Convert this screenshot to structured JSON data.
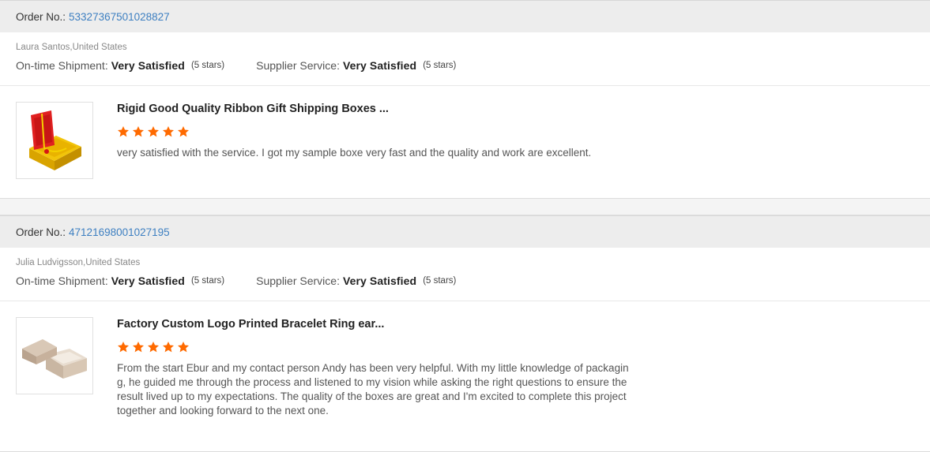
{
  "labels": {
    "order_no": "Order No.:",
    "shipment": "On-time Shipment:",
    "supplier": "Supplier Service:"
  },
  "reviews": [
    {
      "order_no": "53327367501028827",
      "buyer": "Laura Santos,United States",
      "shipment_value": "Very Satisfied",
      "shipment_stars": "(5 stars)",
      "supplier_value": "Very Satisfied",
      "supplier_stars": "(5 stars)",
      "product_title": "Rigid Good Quality Ribbon Gift Shipping Boxes ...",
      "rating": 5,
      "text": "very satisfied with the service. I got my sample boxe very fast and the quality and work are excellent.",
      "image_icon": "red-gift-box-image"
    },
    {
      "order_no": "47121698001027195",
      "buyer": "Julia Ludvigsson,United States",
      "shipment_value": "Very Satisfied",
      "shipment_stars": "(5 stars)",
      "supplier_value": "Very Satisfied",
      "supplier_stars": "(5 stars)",
      "product_title": "Factory Custom Logo Printed Bracelet Ring ear...",
      "rating": 5,
      "text": "From the start Ebur and my contact person Andy has been very helpful. With my little knowledge of packaging, he guided me through the process and listened to my vision while asking the right questions to ensure the result lived up to my expectations. The quality of the boxes are great and I'm excited to complete this project together and looking forward to the next one.",
      "image_icon": "kraft-box-image"
    }
  ],
  "colors": {
    "star": "#ff6a00",
    "link": "#3d7fc1",
    "header_bg": "#ededed"
  }
}
